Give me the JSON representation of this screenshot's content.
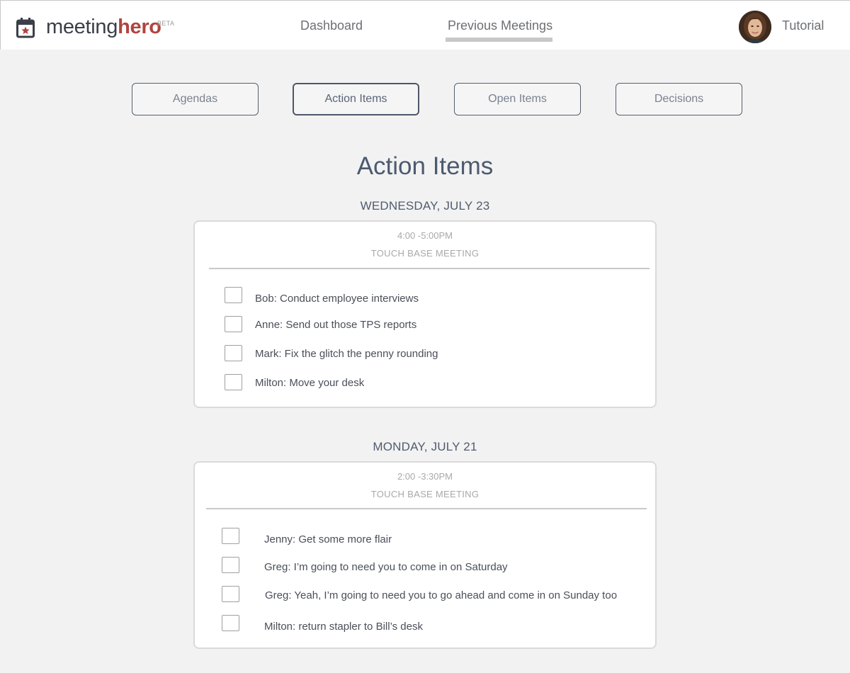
{
  "brand": {
    "name_part1": "meeting",
    "name_part2": "hero",
    "badge": "BETA"
  },
  "nav": {
    "dashboard": "Dashboard",
    "previous_meetings": "Previous Meetings",
    "tutorial": "Tutorial"
  },
  "tabs": {
    "agendas": "Agendas",
    "action_items": "Action Items",
    "open_items": "Open Items",
    "decisions": "Decisions"
  },
  "page_title": "Action Items",
  "meetings": [
    {
      "date": "WEDNESDAY, JULY 23",
      "time": "4:00 -5:00PM",
      "name": "TOUCH BASE MEETING",
      "items": [
        "Bob: Conduct employee interviews",
        "Anne: Send out those TPS reports",
        "Mark: Fix the glitch the penny rounding",
        "Milton: Move your desk"
      ]
    },
    {
      "date": "MONDAY, JULY 21",
      "time": "2:00 -3:30PM",
      "name": "TOUCH BASE MEETING",
      "items": [
        "Jenny: Get some more flair",
        "Greg: I’m going to need you to come in on Saturday",
        "Greg: Yeah, I’m going to need you to go ahead and come in on Sunday too",
        "Milton: return stapler to Bill’s desk"
      ]
    }
  ],
  "icons": {
    "logo": "calendar-star-icon",
    "avatar": "user-avatar"
  },
  "colors": {
    "accent": "#b0443f",
    "text": "#4c5a70",
    "background": "#f2f2f2"
  }
}
